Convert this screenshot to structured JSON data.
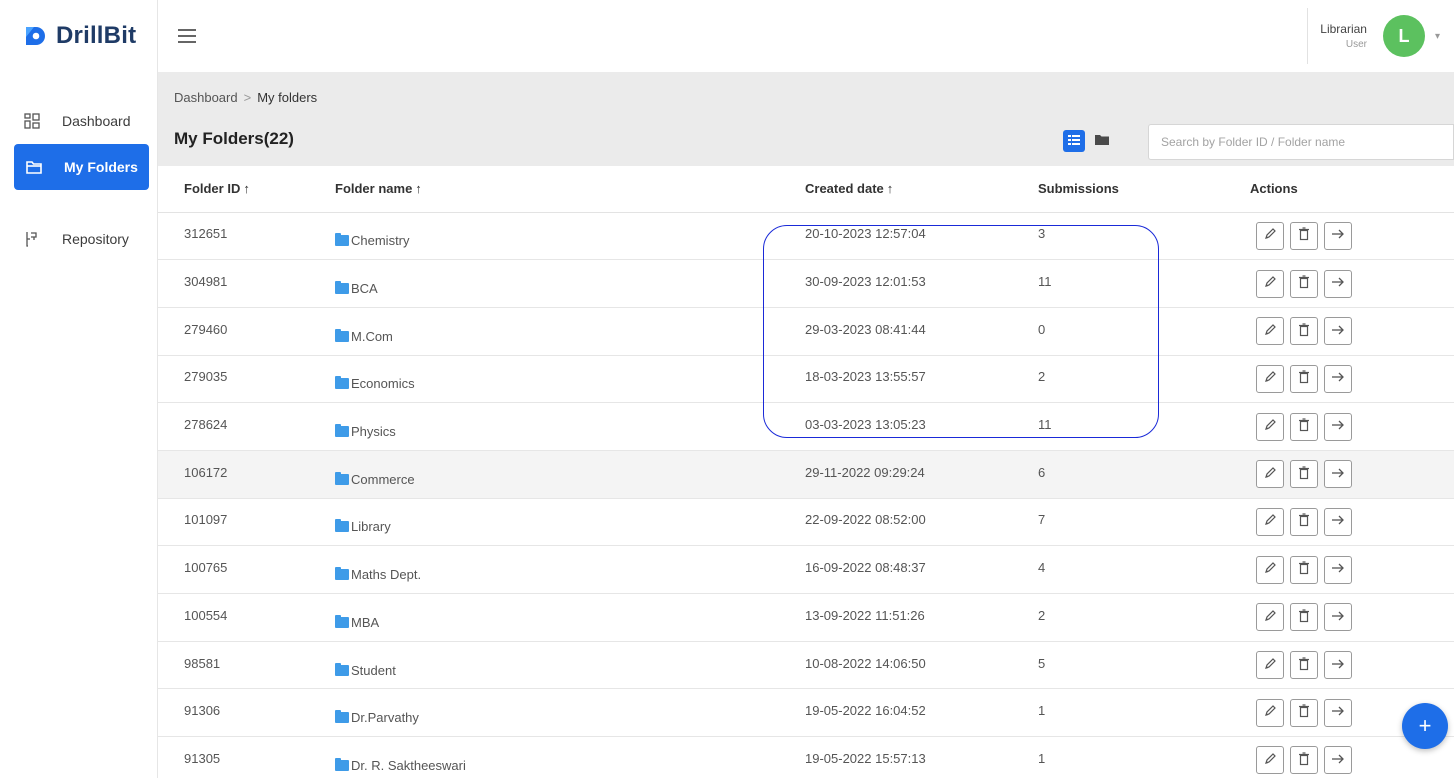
{
  "brand": {
    "name": "DrillBit",
    "accent": "#1e6ee8"
  },
  "sidebar": {
    "items": [
      {
        "label": "Dashboard",
        "icon": "dashboard-grid-icon"
      },
      {
        "label": "My Folders",
        "icon": "folder-icon",
        "active": true
      },
      {
        "label": "Repository",
        "icon": "repository-icon"
      }
    ]
  },
  "header": {
    "user": {
      "name": "Librarian",
      "role": "User",
      "avatar_letter": "L"
    }
  },
  "breadcrumb": {
    "root": "Dashboard",
    "separator": ">",
    "current": "My folders"
  },
  "page": {
    "title": "My Folders(22)"
  },
  "search": {
    "placeholder": "Search by Folder ID / Folder name"
  },
  "table": {
    "columns": [
      "Folder ID",
      "Folder name",
      "Created date",
      "Submissions",
      "Actions"
    ],
    "sort_arrow": "↑",
    "rows": [
      {
        "id": "312651",
        "name": "Chemistry",
        "date": "20-10-2023 12:57:04",
        "submissions": "3"
      },
      {
        "id": "304981",
        "name": "BCA",
        "date": "30-09-2023 12:01:53",
        "submissions": "11"
      },
      {
        "id": "279460",
        "name": "M.Com",
        "date": "29-03-2023 08:41:44",
        "submissions": "0"
      },
      {
        "id": "279035",
        "name": "Economics",
        "date": "18-03-2023 13:55:57",
        "submissions": "2"
      },
      {
        "id": "278624",
        "name": "Physics",
        "date": "03-03-2023 13:05:23",
        "submissions": "11"
      },
      {
        "id": "106172",
        "name": "Commerce",
        "date": "29-11-2022 09:29:24",
        "submissions": "6"
      },
      {
        "id": "101097",
        "name": "Library",
        "date": "22-09-2022 08:52:00",
        "submissions": "7"
      },
      {
        "id": "100765",
        "name": "Maths Dept.",
        "date": "16-09-2022 08:48:37",
        "submissions": "4"
      },
      {
        "id": "100554",
        "name": "MBA",
        "date": "13-09-2022 11:51:26",
        "submissions": "2"
      },
      {
        "id": "98581",
        "name": "Student",
        "date": "10-08-2022 14:06:50",
        "submissions": "5"
      },
      {
        "id": "91306",
        "name": "Dr.Parvathy",
        "date": "19-05-2022 16:04:52",
        "submissions": "1"
      },
      {
        "id": "91305",
        "name": "Dr. R. Saktheeswari",
        "date": "19-05-2022 15:57:13",
        "submissions": "1"
      }
    ],
    "action_icons": [
      "edit-pencil-icon",
      "delete-trash-icon",
      "open-arrow-icon"
    ]
  },
  "fab": {
    "label": "+"
  },
  "colors": {
    "folder_icon": "#3e9be8",
    "avatar": "#5cc15f",
    "highlight_outline": "#1a2ad8"
  }
}
